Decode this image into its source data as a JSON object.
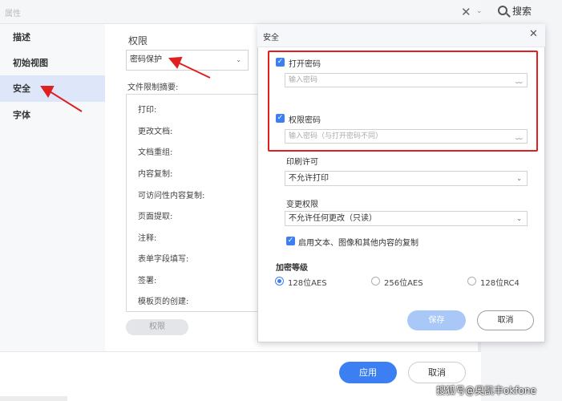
{
  "window": {
    "title": "属性"
  },
  "search": {
    "label": "搜索"
  },
  "sidebar": {
    "items": [
      {
        "label": "描述"
      },
      {
        "label": "初始视图"
      },
      {
        "label": "安全"
      },
      {
        "label": "字体"
      }
    ]
  },
  "permissions": {
    "title": "权限",
    "method_value": "密码保护",
    "summary_label": "文件限制摘要:",
    "summary_items": [
      "打印:",
      "更改文档:",
      "文档重组:",
      "内容复制:",
      "可访问性内容复制:",
      "页面提取:",
      "注释:",
      "表单字段填写:",
      "签署:",
      "模板页的创建:"
    ],
    "button_label": "权限"
  },
  "footer": {
    "apply_label": "应用",
    "cancel_label": "取消"
  },
  "dialog": {
    "title": "安全",
    "open_password": {
      "label": "打开密码",
      "checked": true,
      "placeholder": "输入密码"
    },
    "perm_password": {
      "label": "权限密码",
      "checked": true,
      "placeholder": "输入密码（与打开密码不同）"
    },
    "print": {
      "label": "印刷许可",
      "value": "不允许打印"
    },
    "change": {
      "label": "变更权限",
      "value": "不允许任何更改（只读）"
    },
    "copy_option": {
      "label": "启用文本、图像和其他内容的复制",
      "checked": true
    },
    "encryption": {
      "title": "加密等级",
      "options": [
        {
          "label": "128位AES",
          "selected": true
        },
        {
          "label": "256位AES",
          "selected": false
        },
        {
          "label": "128位RC4",
          "selected": false
        }
      ]
    },
    "save_label": "保存",
    "cancel_label": "取消"
  },
  "watermark": "搜狐号@奥凯丰okfone",
  "colors": {
    "accent": "#3b7ff2",
    "highlight": "#e02020",
    "sidebar_active": "#dde7f9"
  }
}
